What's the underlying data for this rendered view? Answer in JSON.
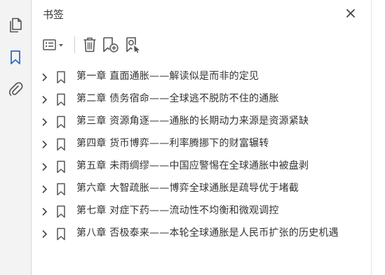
{
  "panel": {
    "title": "书签"
  },
  "rail": {
    "icons": [
      "pages-icon",
      "bookmark-icon",
      "attachment-icon"
    ],
    "active_color": "#2c6ccf"
  },
  "toolbar": {
    "icons": [
      "options-menu-icon",
      "delete-icon",
      "add-bookmark-icon",
      "bookmark-search-icon"
    ]
  },
  "bookmarks": [
    {
      "label": "第一章  直面通胀——解读似是而非的定见"
    },
    {
      "label": "第二章  债务宿命——全球逃不脱防不住的通胀"
    },
    {
      "label": "第三章  资源角逐——通胀的长期动力来源是资源紧缺"
    },
    {
      "label": "第四章  货币博弈——利率腾挪下的财富辗转"
    },
    {
      "label": "第五章  未雨绸缪——中国应警惕在全球通胀中被盘剥"
    },
    {
      "label": "第六章  大智疏胀——博弈全球通胀是疏导优于堵截"
    },
    {
      "label": "第七章  对症下药——流动性不均衡和微观调控"
    },
    {
      "label": "第八章  否极泰来——本轮全球通胀是人民币扩张的历史机遇"
    }
  ]
}
